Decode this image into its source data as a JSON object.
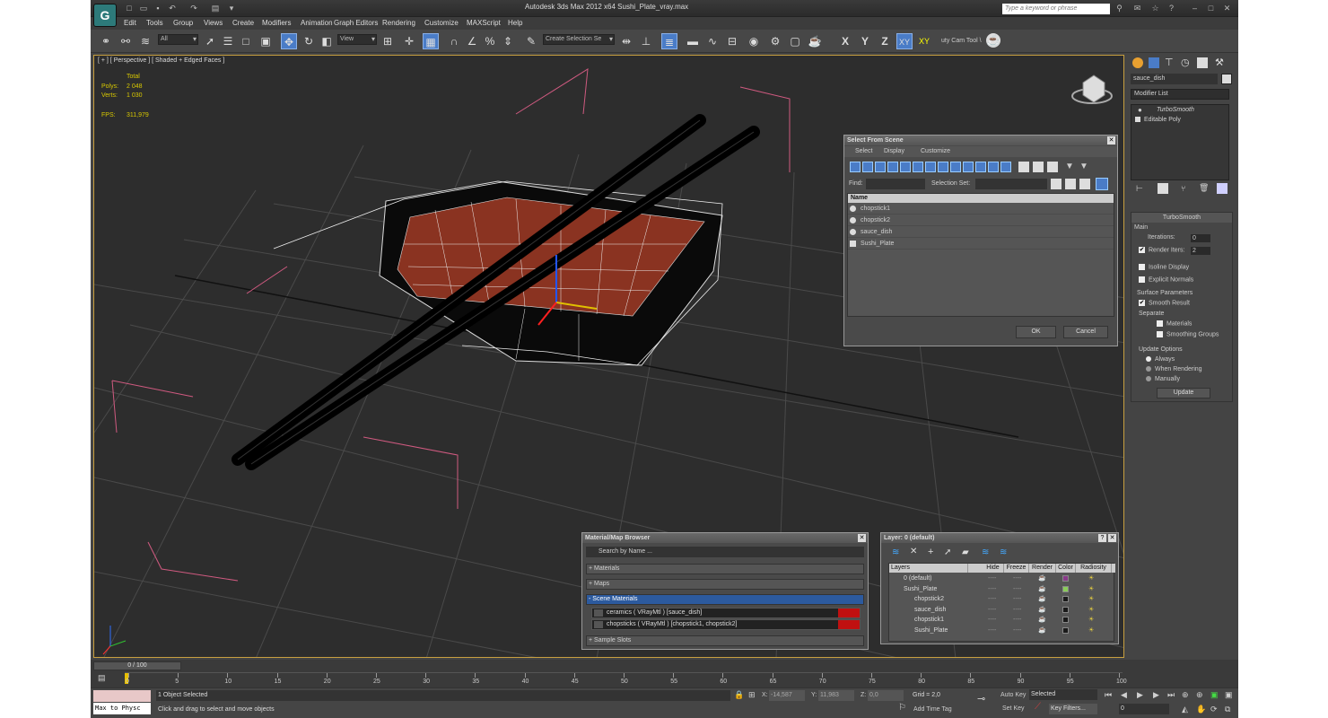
{
  "app": {
    "title": "Autodesk 3ds Max  2012 x64      Sushi_Plate_vray.max",
    "search_placeholder": "Type a keyword or phrase",
    "logo": "3ds-max-logo"
  },
  "menu": [
    "Edit",
    "Tools",
    "Group",
    "Views",
    "Create",
    "Modifiers",
    "Animation",
    "Graph Editors",
    "Rendering",
    "Customize",
    "MAXScript",
    "Help"
  ],
  "toolbar": {
    "filter": "All",
    "view": "View",
    "selection_set": "Create Selection Se",
    "axes": [
      "X",
      "Y",
      "Z",
      "XY",
      "XY"
    ],
    "camtool": "uty Cam Tool \\"
  },
  "viewport": {
    "label": "[ + ] [ Perspective ] [ Shaded + Edged Faces ]",
    "stats": {
      "total": "Total",
      "polys_label": "Polys:",
      "polys": "2 048",
      "verts_label": "Verts:",
      "verts": "1 030",
      "fps_label": "FPS:",
      "fps": "311,979"
    }
  },
  "select_dialog": {
    "title": "Select From Scene",
    "tabs": [
      "Select",
      "Display",
      "Customize"
    ],
    "find_label": "Find:",
    "selset_label": "Selection Set:",
    "column": "Name",
    "items": [
      "chopstick1",
      "chopstick2",
      "sauce_dish",
      "Sushi_Plate"
    ],
    "ok": "OK",
    "cancel": "Cancel"
  },
  "material_browser": {
    "title": "Material/Map Browser",
    "search": "Search by Name ...",
    "sections": [
      "+ Materials",
      "+ Maps",
      "- Scene Materials"
    ],
    "scene_materials": [
      "ceramics  ( VRayMtl ) [sauce_dish]",
      "chopsticks  ( VRayMtl ) [chopstick1, chopstick2]"
    ],
    "sample_slots": "+ Sample Slots"
  },
  "layer_dialog": {
    "title": "Layer: 0 (default)",
    "columns": [
      "Layers",
      "Hide",
      "Freeze",
      "Render",
      "Color",
      "Radiosity"
    ],
    "rows": [
      {
        "name": "0 (default)",
        "indent": 1,
        "color": "#8a3a8a"
      },
      {
        "name": "Sushi_Plate",
        "indent": 1,
        "color": "#8acc5a"
      },
      {
        "name": "chopstick2",
        "indent": 2,
        "color": "#1a1a1a"
      },
      {
        "name": "sauce_dish",
        "indent": 2,
        "color": "#1a1a1a"
      },
      {
        "name": "chopstick1",
        "indent": 2,
        "color": "#1a1a1a"
      },
      {
        "name": "Sushi_Plate",
        "indent": 2,
        "color": "#1a1a1a"
      }
    ],
    "dash": "----"
  },
  "command_panel": {
    "object_name": "sauce_dish",
    "modifier_list": "Modifier List",
    "stack": [
      "TurboSmooth",
      "Editable Poly"
    ],
    "rollout": "TurboSmooth",
    "main": "Main",
    "iterations_label": "Iterations:",
    "iterations": "0",
    "render_iters_label": "Render Iters:",
    "render_iters": "2",
    "isoline": "Isoline Display",
    "explicit": "Explicit Normals",
    "surface": "Surface Parameters",
    "smooth_result": "Smooth Result",
    "separate": "Separate",
    "materials": "Materials",
    "smoothing": "Smoothing Groups",
    "update_options": "Update Options",
    "always": "Always",
    "when_rendering": "When Rendering",
    "manually": "Manually",
    "update": "Update"
  },
  "timeline": {
    "frame": "0 / 100",
    "ticks": [
      "0",
      "5",
      "10",
      "15",
      "20",
      "25",
      "30",
      "35",
      "40",
      "45",
      "50",
      "55",
      "60",
      "65",
      "70",
      "75",
      "80",
      "85",
      "90",
      "95",
      "100"
    ]
  },
  "status": {
    "maxscript": "Max to Physc",
    "selected": "1 Object Selected",
    "prompt": "Click and drag to select and move objects",
    "x_label": "X:",
    "x": "-14,587",
    "y_label": "Y:",
    "y": "11,983",
    "z_label": "Z:",
    "z": "0,0",
    "grid": "Grid = 2,0",
    "add_time_tag": "Add Time Tag",
    "auto_key": "Auto Key",
    "set_key": "Set Key",
    "selected_combo": "Selected",
    "key_filters": "Key Filters...",
    "frame": "0"
  }
}
